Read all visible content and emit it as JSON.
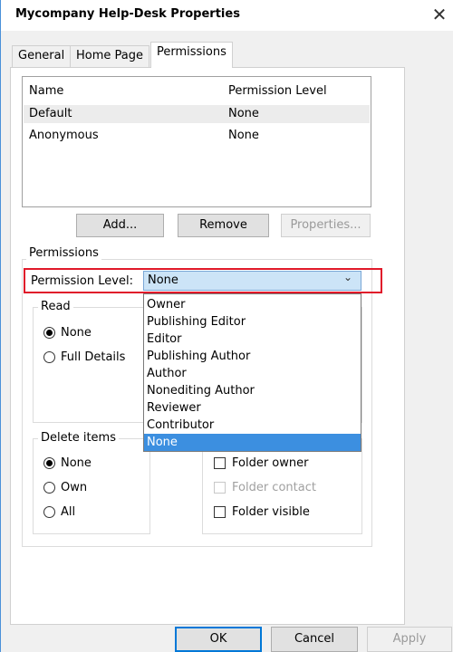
{
  "window": {
    "title": "Mycompany Help-Desk Properties",
    "close_glyph": "✕"
  },
  "tabs": [
    {
      "label": "General"
    },
    {
      "label": "Home Page"
    },
    {
      "label": "Permissions",
      "active": true
    }
  ],
  "list": {
    "headers": {
      "name": "Name",
      "level": "Permission Level"
    },
    "rows": [
      {
        "name": "Default",
        "level": "None",
        "selected": true
      },
      {
        "name": "Anonymous",
        "level": "None"
      }
    ]
  },
  "list_buttons": {
    "add": "Add...",
    "remove": "Remove",
    "properties": "Properties..."
  },
  "permissions": {
    "group_label": "Permissions",
    "level_label": "Permission Level:",
    "level_value": "None",
    "dropdown_options": [
      "Owner",
      "Publishing Editor",
      "Editor",
      "Publishing Author",
      "Author",
      "Nonediting Author",
      "Reviewer",
      "Contributor",
      "None"
    ],
    "selected_option": "None",
    "read": {
      "label": "Read",
      "options": [
        "None",
        "Full Details"
      ],
      "selected": "None"
    },
    "delete": {
      "label": "Delete items",
      "options": [
        "None",
        "Own",
        "All"
      ],
      "selected": "None"
    },
    "other": {
      "folder_owner": "Folder owner",
      "folder_contact": "Folder contact",
      "folder_visible": "Folder visible"
    }
  },
  "footer": {
    "ok": "OK",
    "cancel": "Cancel",
    "apply": "Apply"
  },
  "colors": {
    "highlight": "#e0192a",
    "selection": "#3c8fe0",
    "combo_bg": "#cce4f7"
  }
}
